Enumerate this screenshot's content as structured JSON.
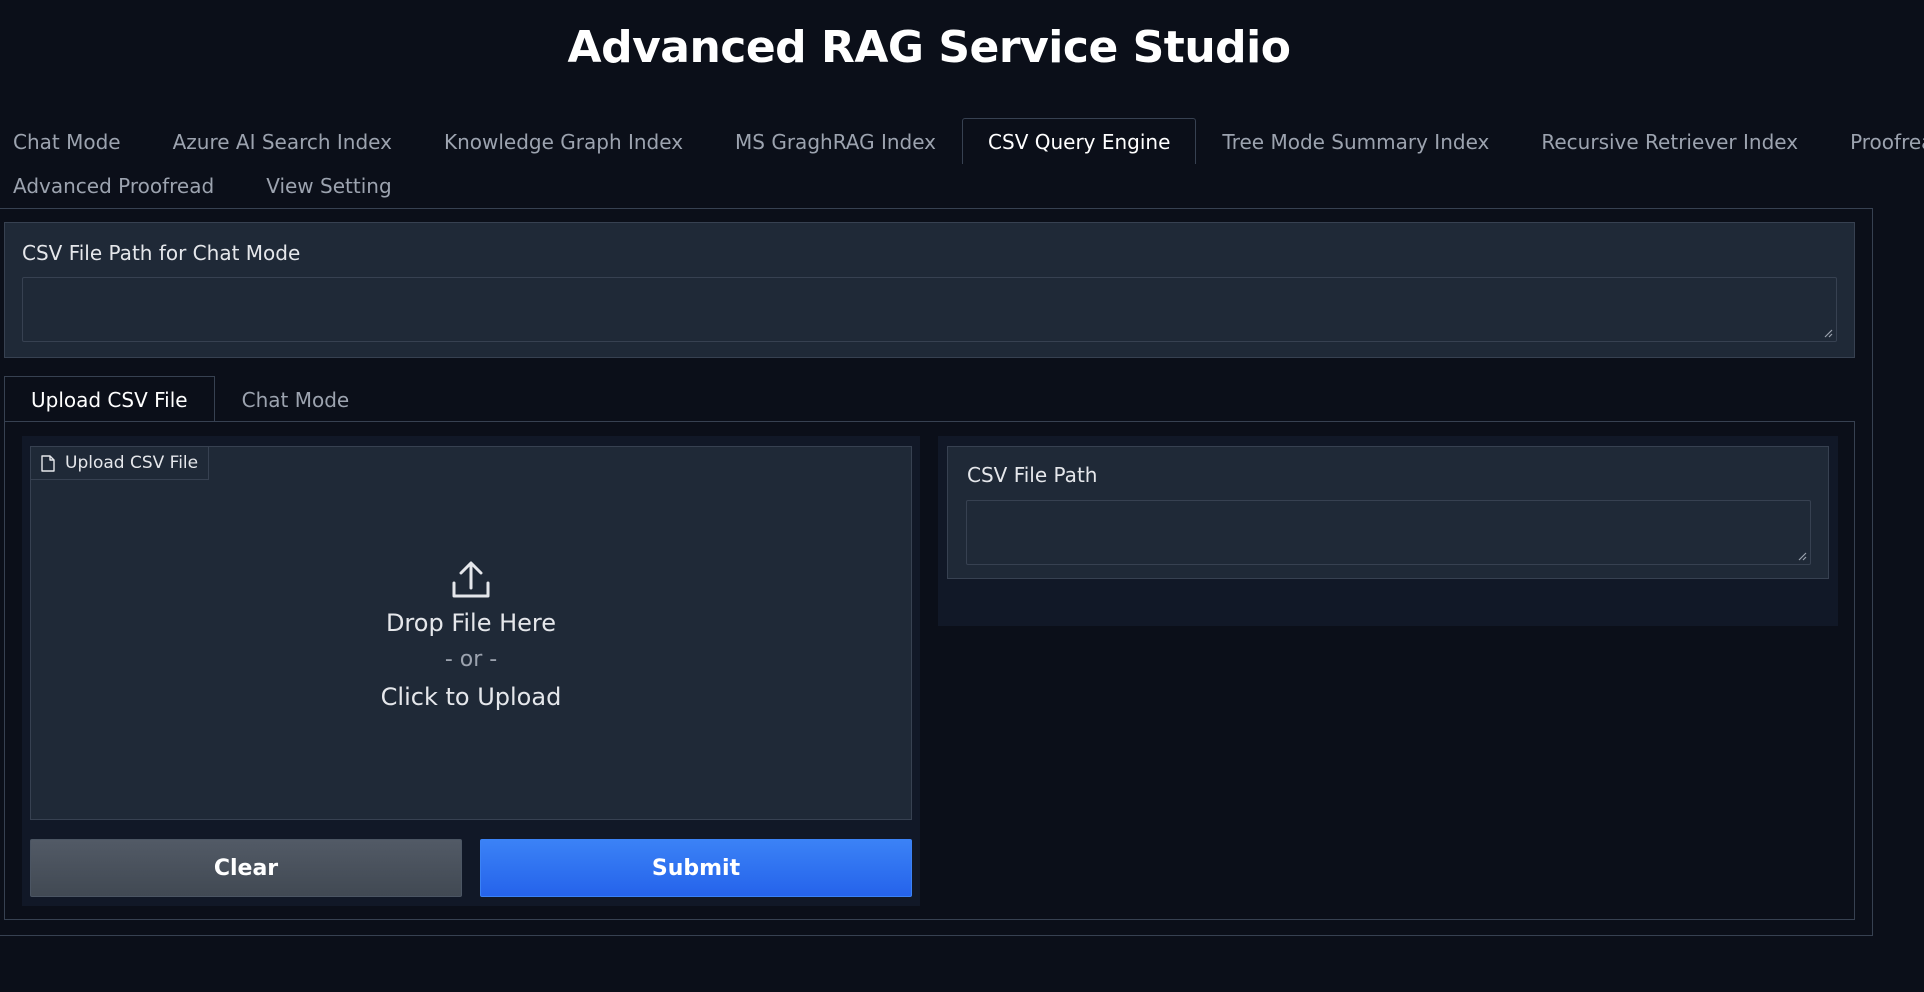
{
  "app": {
    "title": "Advanced RAG Service Studio"
  },
  "main_tabs": {
    "row1": [
      {
        "label": "Chat Mode"
      },
      {
        "label": "Azure AI Search Index"
      },
      {
        "label": "Knowledge Graph Index"
      },
      {
        "label": "MS GraghRAG Index"
      },
      {
        "label": "CSV Query Engine",
        "active": true
      },
      {
        "label": "Tree Mode Summary Index"
      },
      {
        "label": "Recursive Retriever Index"
      },
      {
        "label": "Proofread"
      }
    ],
    "row2": [
      {
        "label": "Advanced Proofread"
      },
      {
        "label": "View Setting"
      }
    ]
  },
  "csv_chat_path": {
    "label": "CSV File Path for Chat Mode",
    "value": ""
  },
  "sub_tabs": [
    {
      "label": "Upload CSV File",
      "active": true
    },
    {
      "label": "Chat Mode"
    }
  ],
  "upload": {
    "tag_label": "Upload CSV File",
    "tag_icon": "file-icon",
    "icon": "upload-icon",
    "drop_text": "Drop File Here",
    "or_text": "- or -",
    "click_text": "Click to Upload"
  },
  "csv_path": {
    "label": "CSV File Path",
    "value": ""
  },
  "buttons": {
    "clear": "Clear",
    "submit": "Submit"
  },
  "colors": {
    "background": "#0b0f19",
    "panel": "#1f2937",
    "border": "#374151",
    "primary": "#3b82f6",
    "secondary": "#4b5563"
  }
}
